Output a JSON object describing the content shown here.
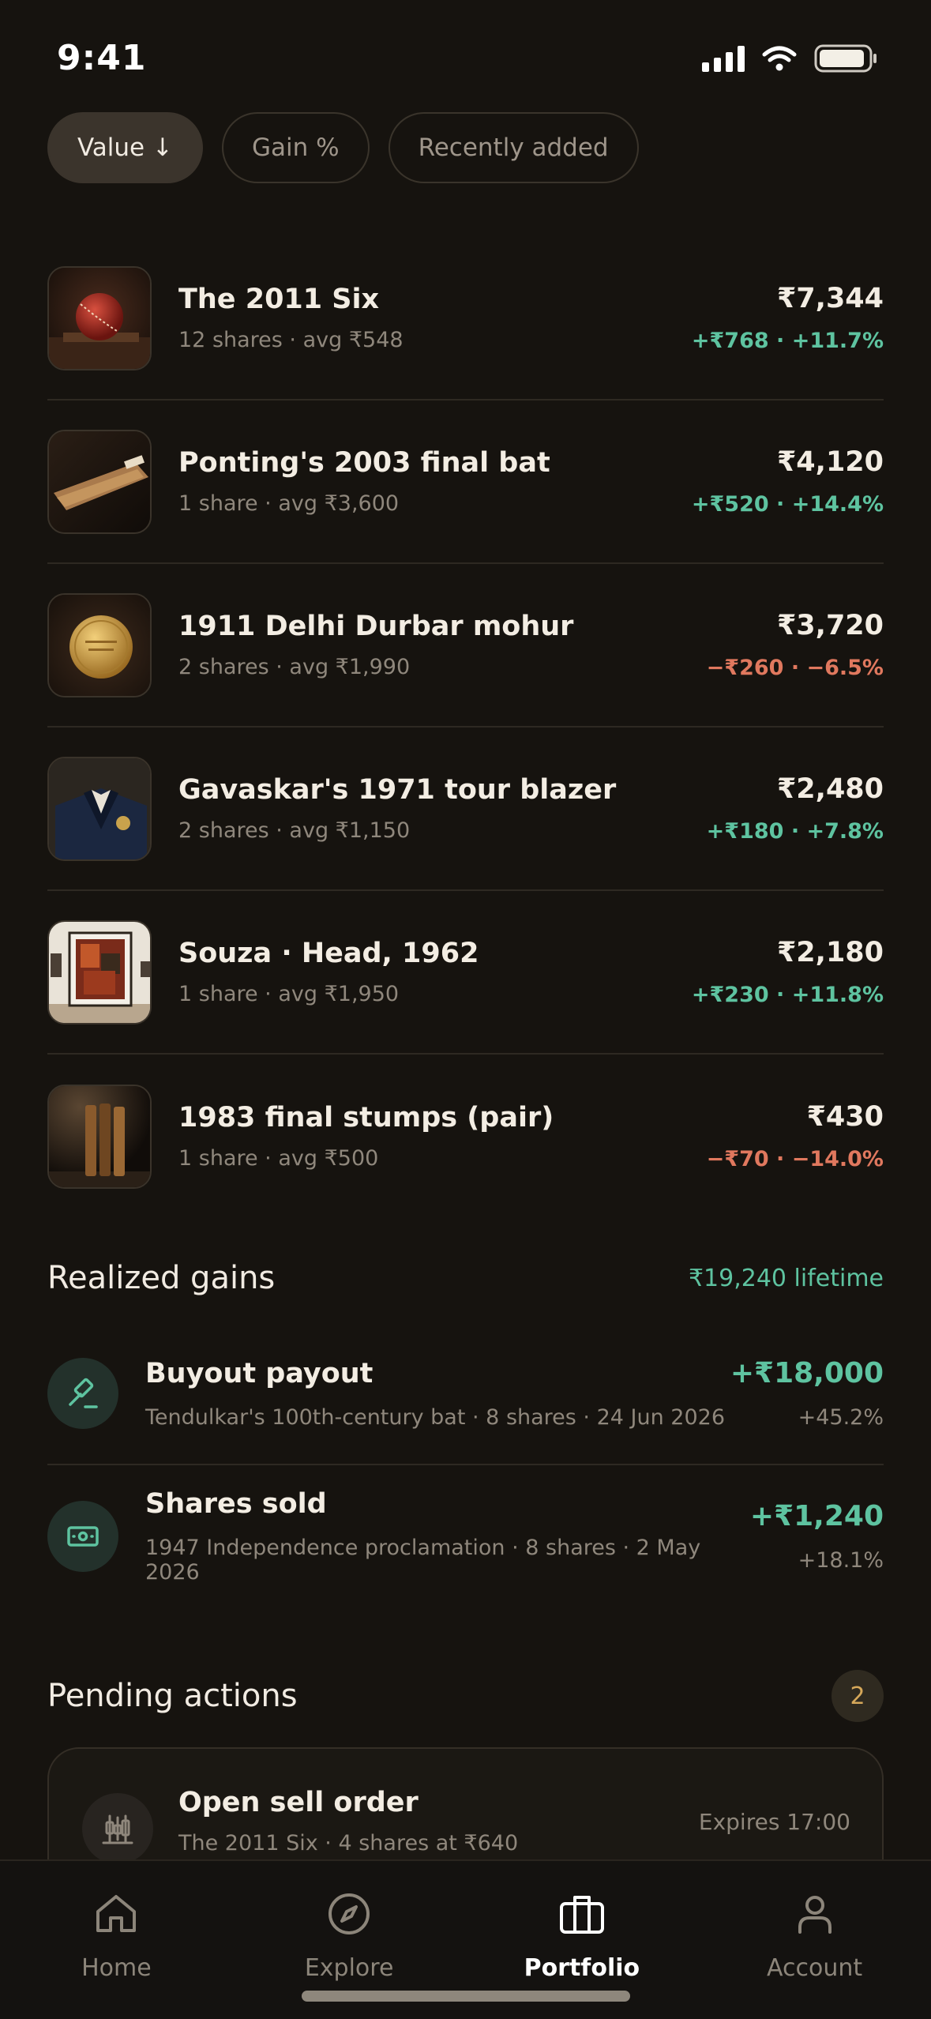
{
  "status_bar": {
    "time": "9:41"
  },
  "filters": [
    {
      "label": "Value ↓",
      "active": true
    },
    {
      "label": "Gain %",
      "active": false
    },
    {
      "label": "Recently added",
      "active": false
    }
  ],
  "holdings": [
    {
      "title": "The 2011 Six",
      "sub": "12 shares · avg ₹548",
      "value": "₹7,344",
      "change": "+₹768 · +11.7%",
      "trend": "up",
      "image": "cricket-ball-image"
    },
    {
      "title": "Ponting's 2003 final bat",
      "sub": "1 share · avg ₹3,600",
      "value": "₹4,120",
      "change": "+₹520 · +14.4%",
      "trend": "up",
      "image": "cricket-bat-image"
    },
    {
      "title": "1911 Delhi Durbar mohur",
      "sub": "2 shares · avg ₹1,990",
      "value": "₹3,720",
      "change": "−₹260 · −6.5%",
      "trend": "down",
      "image": "gold-coin-image"
    },
    {
      "title": "Gavaskar's 1971 tour blazer",
      "sub": "2 shares · avg ₹1,150",
      "value": "₹2,480",
      "change": "+₹180 · +7.8%",
      "trend": "up",
      "image": "blazer-image"
    },
    {
      "title": "Souza · Head, 1962",
      "sub": "1 share · avg ₹1,950",
      "value": "₹2,180",
      "change": "+₹230 · +11.8%",
      "trend": "up",
      "image": "painting-image"
    },
    {
      "title": "1983 final stumps (pair)",
      "sub": "1 share · avg ₹500",
      "value": "₹430",
      "change": "−₹70 · −14.0%",
      "trend": "down",
      "image": "stumps-image"
    }
  ],
  "realized": {
    "title": "Realized gains",
    "lifetime": "₹19,240 lifetime",
    "items": [
      {
        "title": "Buyout payout",
        "sub": "Tendulkar's 100th-century bat · 8 shares · 24 Jun 2026",
        "amount": "+₹18,000",
        "pct": "+45.2%",
        "icon": "gavel-icon"
      },
      {
        "title": "Shares sold",
        "sub": "1947 Independence proclamation · 8 shares · 2 May 2026",
        "amount": "+₹1,240",
        "pct": "+18.1%",
        "icon": "banknote-icon"
      }
    ]
  },
  "pending": {
    "title": "Pending actions",
    "count": "2",
    "card": {
      "title": "Open sell order",
      "sub": "The 2011 Six · 4 shares at ₹640",
      "expires": "Expires 17:00",
      "icon": "candlestick-icon"
    }
  },
  "tabs": [
    {
      "label": "Home",
      "icon": "home-icon",
      "active": false
    },
    {
      "label": "Explore",
      "icon": "compass-icon",
      "active": false
    },
    {
      "label": "Portfolio",
      "icon": "briefcase-icon",
      "active": true
    },
    {
      "label": "Account",
      "icon": "person-icon",
      "active": false
    }
  ],
  "colors": {
    "background": "#16130f",
    "positive": "#5ec3a0",
    "negative": "#e0785e",
    "badge": "#d6a85a"
  }
}
